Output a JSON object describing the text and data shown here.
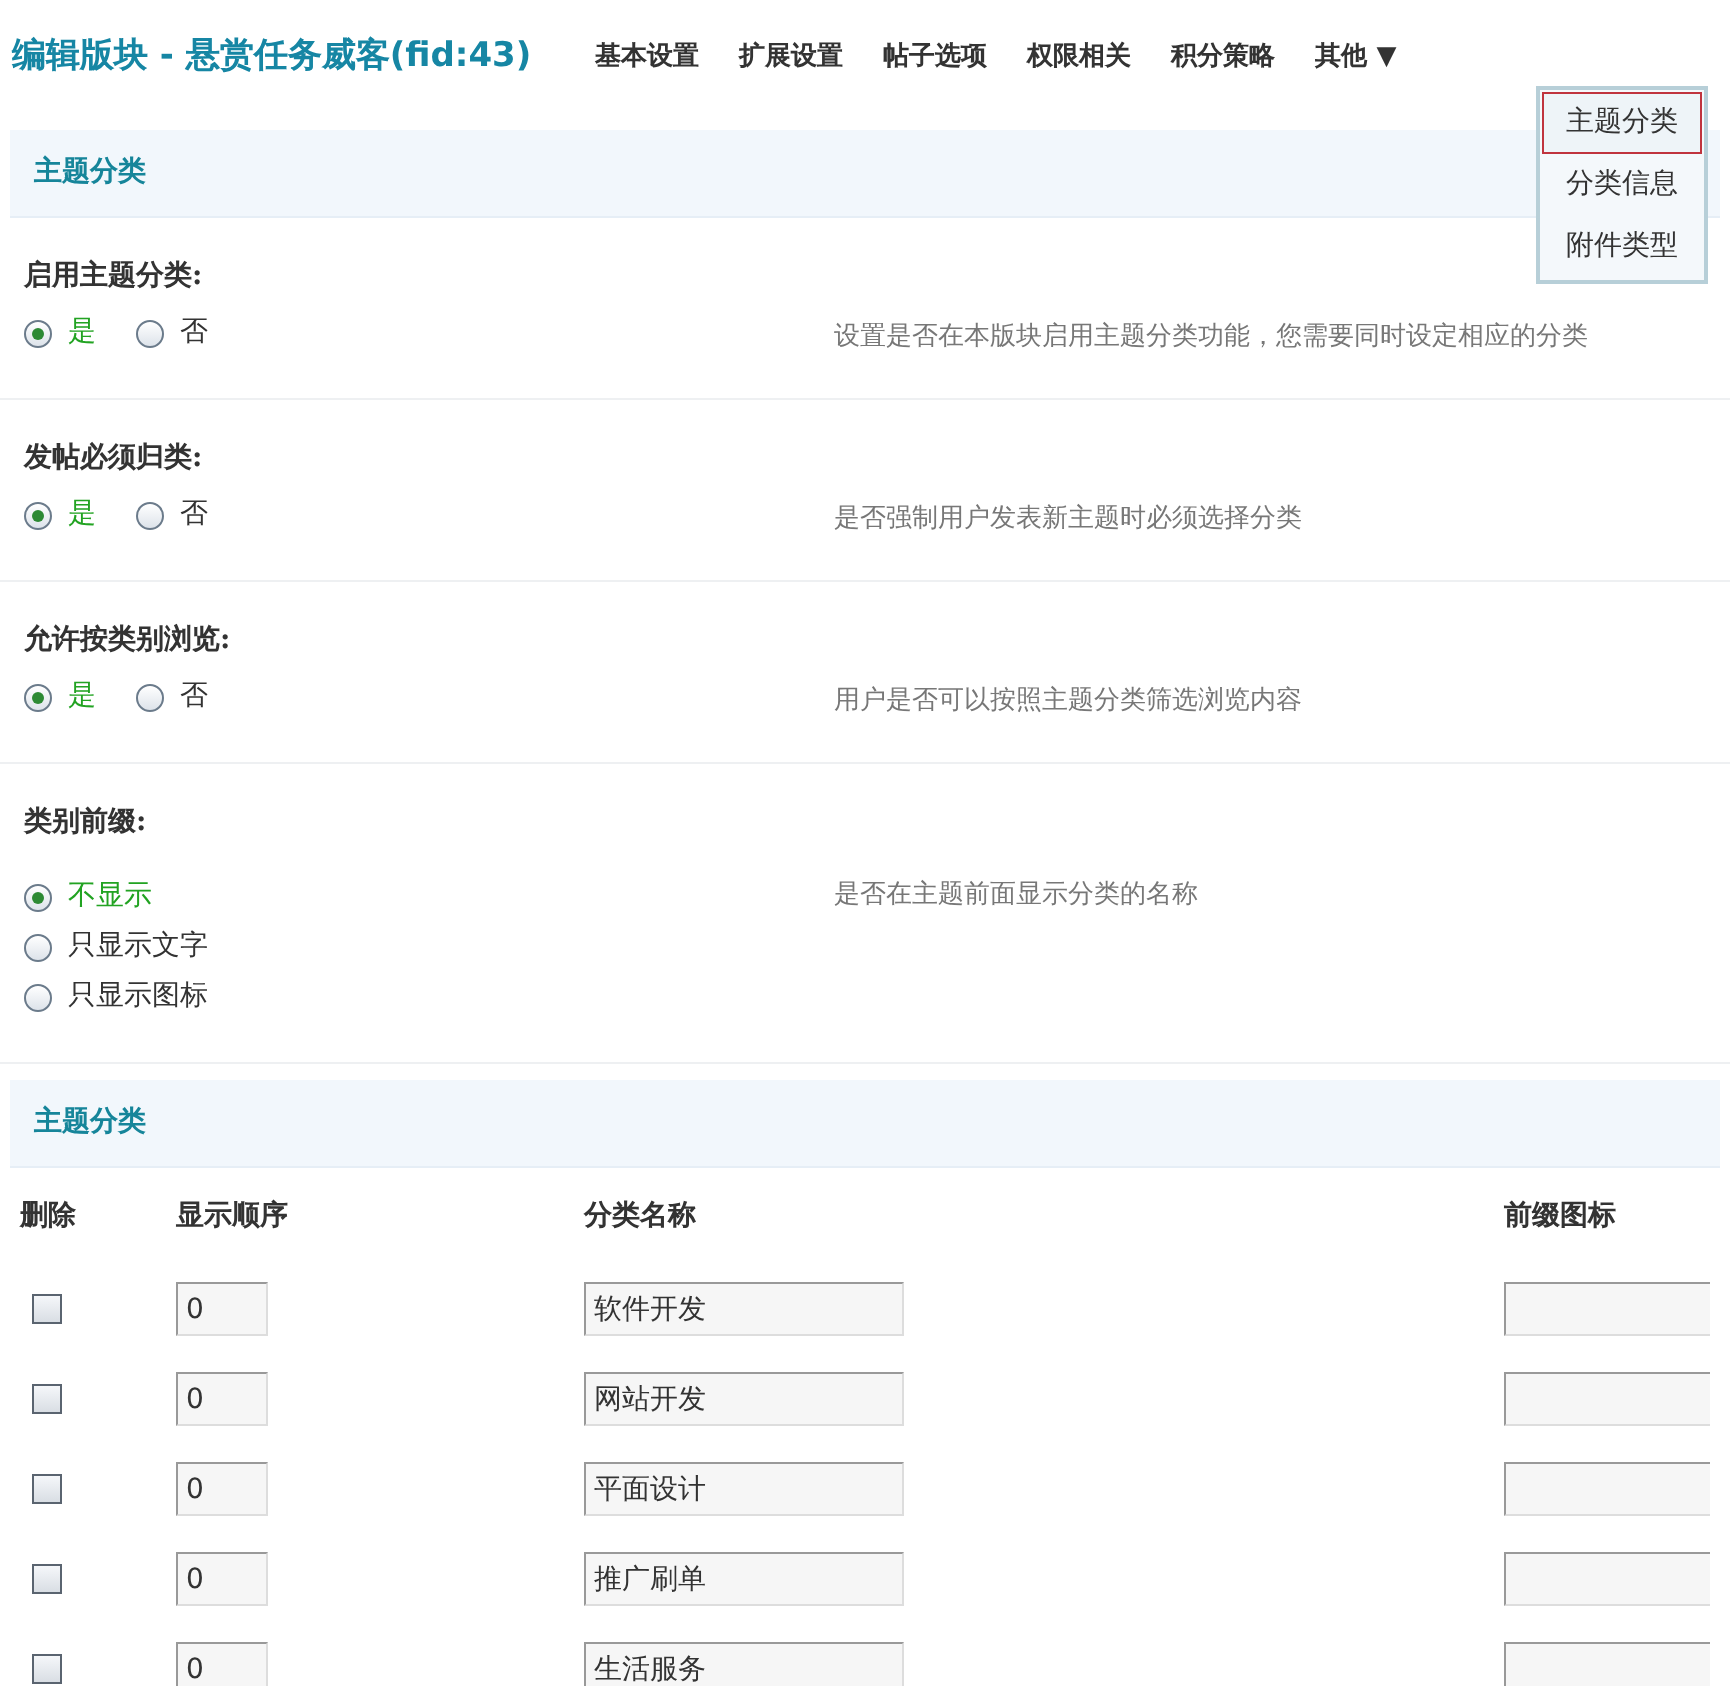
{
  "header": {
    "title": "编辑版块 - 悬赏任务威客(fid:43)"
  },
  "nav": [
    {
      "label": "基本设置"
    },
    {
      "label": "扩展设置"
    },
    {
      "label": "帖子选项"
    },
    {
      "label": "权限相关"
    },
    {
      "label": "积分策略"
    },
    {
      "label": "其他",
      "caret": "▼"
    }
  ],
  "dropdown": [
    {
      "label": "主题分类",
      "selected": true
    },
    {
      "label": "分类信息",
      "selected": false
    },
    {
      "label": "附件类型",
      "selected": false
    }
  ],
  "section_1": {
    "title": "主题分类"
  },
  "settings": [
    {
      "label": "启用主题分类:",
      "kind": "inline",
      "description": "设置是否在本版块启用主题分类功能，您需要同时设定相应的分类",
      "options": [
        {
          "label": "是",
          "selected": true
        },
        {
          "label": "否",
          "selected": false
        }
      ]
    },
    {
      "label": "发帖必须归类:",
      "kind": "inline",
      "description": "是否强制用户发表新主题时必须选择分类",
      "options": [
        {
          "label": "是",
          "selected": true
        },
        {
          "label": "否",
          "selected": false
        }
      ]
    },
    {
      "label": "允许按类别浏览:",
      "kind": "inline",
      "description": "用户是否可以按照主题分类筛选浏览内容",
      "options": [
        {
          "label": "是",
          "selected": true
        },
        {
          "label": "否",
          "selected": false
        }
      ]
    },
    {
      "label": "类别前缀:",
      "kind": "stacked",
      "description": "是否在主题前面显示分类的名称",
      "options": [
        {
          "label": "不显示",
          "selected": true
        },
        {
          "label": "只显示文字",
          "selected": false
        },
        {
          "label": "只显示图标",
          "selected": false
        }
      ]
    }
  ],
  "section_2": {
    "title": "主题分类"
  },
  "table": {
    "columns": [
      "删除",
      "显示顺序",
      "分类名称",
      "前缀图标"
    ],
    "rows": [
      {
        "checked": false,
        "order": "0",
        "name": "软件开发"
      },
      {
        "checked": false,
        "order": "0",
        "name": "网站开发"
      },
      {
        "checked": false,
        "order": "0",
        "name": "平面设计"
      },
      {
        "checked": false,
        "order": "0",
        "name": "推广刷单"
      },
      {
        "checked": false,
        "order": "0",
        "name": "生活服务"
      }
    ]
  }
}
